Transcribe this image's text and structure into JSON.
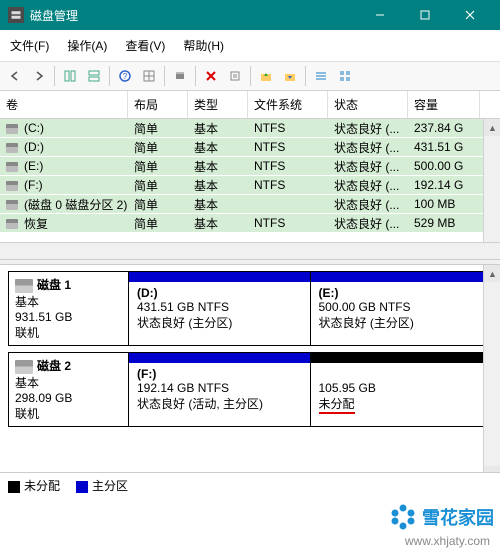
{
  "window": {
    "title": "磁盘管理"
  },
  "menu": {
    "file": "文件(F)",
    "action": "操作(A)",
    "view": "查看(V)",
    "help": "帮助(H)"
  },
  "columns": {
    "volume": "卷",
    "layout": "布局",
    "type": "类型",
    "fs": "文件系统",
    "status": "状态",
    "capacity": "容量"
  },
  "volumes": [
    {
      "name": "(C:)",
      "layout": "简单",
      "type": "基本",
      "fs": "NTFS",
      "status": "状态良好 (...",
      "capacity": "237.84 G"
    },
    {
      "name": "(D:)",
      "layout": "简单",
      "type": "基本",
      "fs": "NTFS",
      "status": "状态良好 (...",
      "capacity": "431.51 G"
    },
    {
      "name": "(E:)",
      "layout": "简单",
      "type": "基本",
      "fs": "NTFS",
      "status": "状态良好 (...",
      "capacity": "500.00 G"
    },
    {
      "name": "(F:)",
      "layout": "简单",
      "type": "基本",
      "fs": "NTFS",
      "status": "状态良好 (...",
      "capacity": "192.14 G"
    },
    {
      "name": "(磁盘 0 磁盘分区 2)",
      "layout": "简单",
      "type": "基本",
      "fs": "",
      "status": "状态良好 (...",
      "capacity": "100 MB"
    },
    {
      "name": "恢复",
      "layout": "简单",
      "type": "基本",
      "fs": "NTFS",
      "status": "状态良好 (...",
      "capacity": "529 MB"
    }
  ],
  "disks": [
    {
      "name": "磁盘 1",
      "type": "基本",
      "size": "931.51 GB",
      "status": "联机",
      "parts": [
        {
          "letter": "(D:)",
          "info": "431.51 GB NTFS",
          "status": "状态良好 (主分区)",
          "bar": "bar-blue"
        },
        {
          "letter": "(E:)",
          "info": "500.00 GB NTFS",
          "status": "状态良好 (主分区)",
          "bar": "bar-blue"
        }
      ]
    },
    {
      "name": "磁盘 2",
      "type": "基本",
      "size": "298.09 GB",
      "status": "联机",
      "parts": [
        {
          "letter": "(F:)",
          "info": "192.14 GB NTFS",
          "status": "状态良好 (活动, 主分区)",
          "bar": "bar-blue"
        },
        {
          "letter": "",
          "info": "105.95 GB",
          "status": "未分配",
          "bar": "bar-black",
          "highlight": true
        }
      ]
    }
  ],
  "legend": {
    "unalloc": "未分配",
    "primary": "主分区"
  },
  "watermark": {
    "brand": "雪花家园",
    "url": "www.xhjaty.com"
  }
}
